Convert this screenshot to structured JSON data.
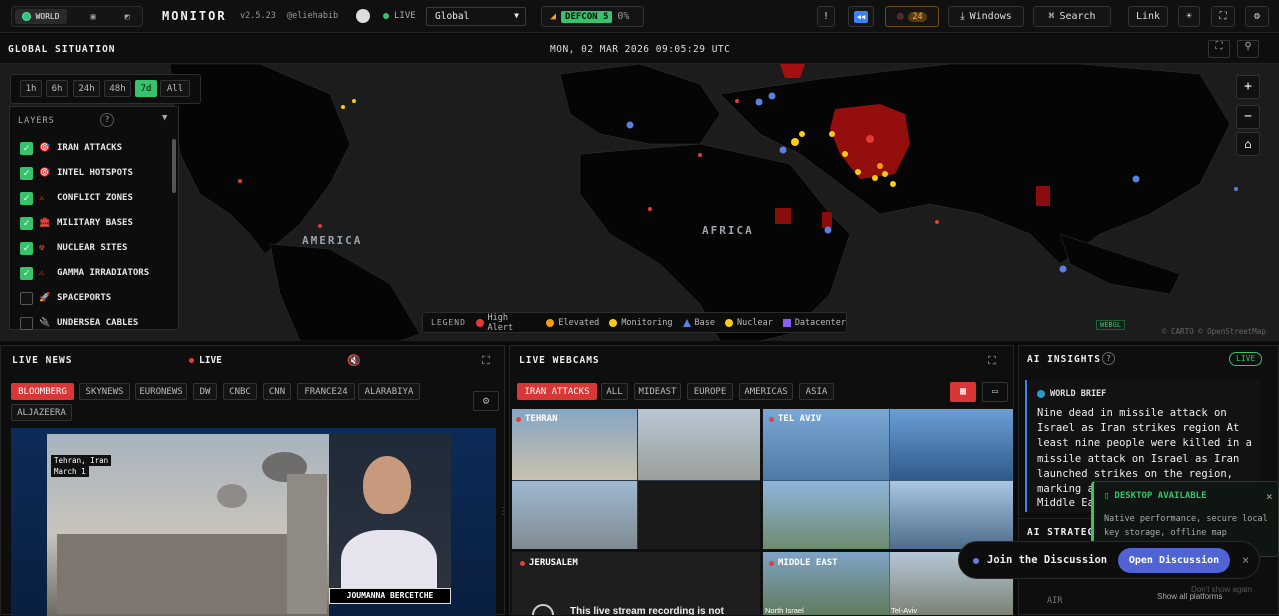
{
  "topbar": {
    "view_switch": {
      "world": "WORLD"
    },
    "title": "MONITOR",
    "version": "v2.5.23",
    "author": "@eliehabib",
    "live": "LIVE",
    "region_select": "Global",
    "defcon_label": "DEFCON 5",
    "defcon_pct": "0%",
    "alert_count": "24",
    "windows": "Windows",
    "search": "Search",
    "link": "Link"
  },
  "situation": {
    "title": "GLOBAL SITUATION",
    "datetime": "MON, 02 MAR 2026 09:05:29 UTC"
  },
  "time_filters": [
    {
      "label": "1h"
    },
    {
      "label": "6h"
    },
    {
      "label": "24h"
    },
    {
      "label": "48h"
    },
    {
      "label": "7d"
    },
    {
      "label": "All"
    }
  ],
  "layers": {
    "title": "LAYERS",
    "help": "?",
    "items": [
      {
        "label": "IRAN ATTACKS",
        "checked": true,
        "icon": "🎯"
      },
      {
        "label": "INTEL HOTSPOTS",
        "checked": true,
        "icon": "🎯"
      },
      {
        "label": "CONFLICT ZONES",
        "checked": true,
        "icon": "⚔"
      },
      {
        "label": "MILITARY BASES",
        "checked": true,
        "icon": "🏛"
      },
      {
        "label": "NUCLEAR SITES",
        "checked": true,
        "icon": "☢"
      },
      {
        "label": "GAMMA IRRADIATORS",
        "checked": true,
        "icon": "⚠"
      },
      {
        "label": "SPACEPORTS",
        "checked": false,
        "icon": "🚀"
      },
      {
        "label": "UNDERSEA CABLES",
        "checked": false,
        "icon": "🔌"
      }
    ]
  },
  "map": {
    "labels": {
      "america": "AMERICA",
      "africa": "AFRICA"
    },
    "legend": {
      "title": "LEGEND",
      "items": [
        {
          "label": "High Alert",
          "color": "#e53935"
        },
        {
          "label": "Elevated",
          "color": "#f59e0b"
        },
        {
          "label": "Monitoring",
          "color": "#facc15"
        },
        {
          "label": "Base",
          "color": "#5b7fe0"
        },
        {
          "label": "Nuclear",
          "color": "#facc15"
        },
        {
          "label": "Datacenter",
          "color": "#8b5cf6"
        }
      ]
    },
    "webgl": "WEBGL",
    "attribution": "© CARTO © OpenStreetMap",
    "zoom_in": "+",
    "zoom_out": "−",
    "home": "⌂"
  },
  "live_news": {
    "title": "LIVE NEWS",
    "live": "LIVE",
    "channels": [
      {
        "label": "BLOOMBERG",
        "active": true
      },
      {
        "label": "SKYNEWS"
      },
      {
        "label": "EURONEWS"
      },
      {
        "label": "DW"
      },
      {
        "label": "CNBC"
      },
      {
        "label": "CNN"
      },
      {
        "label": "FRANCE24"
      },
      {
        "label": "ALARABIYA"
      },
      {
        "label": "ALJAZEERA"
      }
    ],
    "video": {
      "location": "Tehran, Iran",
      "date": "March 1",
      "anchor": "JOUMANNA BERCETCHE"
    }
  },
  "live_webcams": {
    "title": "LIVE WEBCAMS",
    "filters": [
      {
        "label": "IRAN ATTACKS",
        "active": true
      },
      {
        "label": "ALL"
      },
      {
        "label": "MIDEAST"
      },
      {
        "label": "EUROPE"
      },
      {
        "label": "AMERICAS"
      },
      {
        "label": "ASIA"
      }
    ],
    "cams": {
      "tehran": "TEHRAN",
      "telaviv": "TEL AVIV",
      "jerusalem": "JERUSALEM",
      "mideast": "MIDDLE EAST"
    },
    "unavailable": "This live stream recording is not",
    "north_israel": "North Israel",
    "tel_aviv_caption": "Tel-Aviv"
  },
  "ai_insights": {
    "title": "AI INSIGHTS",
    "help": "?",
    "live": "LIVE",
    "brief_title": "WORLD BRIEF",
    "brief_text": "Nine dead in missile attack on Israel as Iran strikes region At least nine people were killed in a missile attack on Israel as Iran launched strikes on the region, marking a",
    "brief_tail": "Middle Eas",
    "strategic": "AI STRATEGI",
    "air": "AIR"
  },
  "desktop_toast": {
    "title": "DESKTOP AVAILABLE",
    "text": "Native performance, secure local key storage, offline map",
    "close": "×"
  },
  "discussion": {
    "text": "Join the Discussion",
    "button": "Open Discussion",
    "close": "×"
  },
  "footer": {
    "dont_show": "Don't show again",
    "all_platforms": "Show all platforms"
  }
}
